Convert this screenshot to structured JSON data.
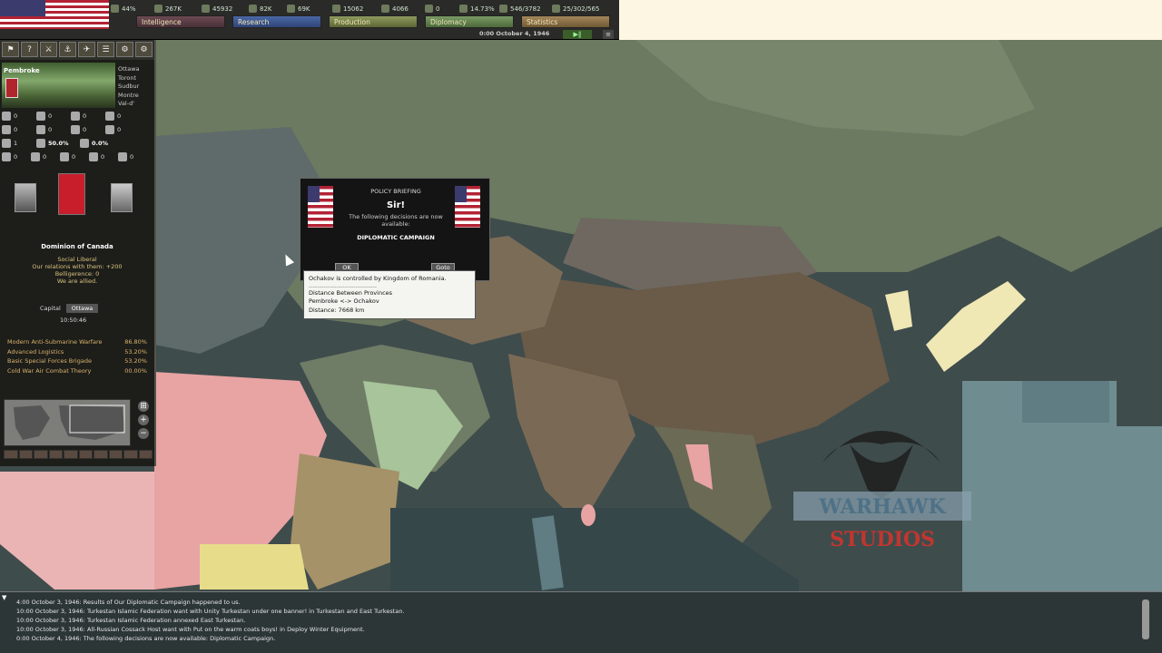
{
  "topbar": {
    "resources": [
      {
        "icon": "energy-icon",
        "value": "44%"
      },
      {
        "icon": "metal-icon",
        "value": "267K"
      },
      {
        "icon": "rare-materials-icon",
        "value": "45932"
      },
      {
        "icon": "oil-icon",
        "value": "82K"
      },
      {
        "icon": "supplies-icon",
        "value": "69K"
      },
      {
        "icon": "money-icon",
        "value": "15062"
      },
      {
        "icon": "manpower-icon",
        "value": "4066"
      },
      {
        "icon": "transports-icon",
        "value": "0"
      },
      {
        "icon": "dissent-icon",
        "value": "14.73%"
      },
      {
        "icon": "national-unity-icon",
        "value": "546/3782"
      },
      {
        "icon": "officers-icon",
        "value": "25/302/565"
      }
    ],
    "tabs": [
      "Intelligence",
      "Research",
      "Production",
      "Diplomacy",
      "Statistics"
    ],
    "date": "0:00 October 4, 1946"
  },
  "left_panel": {
    "toolbar_icons": [
      "hq-icon",
      "help-icon",
      "army-icon",
      "navy-icon",
      "air-icon",
      "ledger-icon",
      "production-icon",
      "options-icon"
    ],
    "province": {
      "name": "Pembroke",
      "cities": [
        "Ottawa",
        "Toront",
        "Sudbur",
        "Montre",
        "Val-d'"
      ]
    },
    "stats": [
      [
        "0",
        "0",
        "0",
        "0"
      ],
      [
        "0",
        "0",
        "0",
        "0"
      ],
      [
        "1",
        "50.0%",
        "0.0%"
      ],
      [
        "0",
        "0",
        "0",
        "0",
        "0"
      ]
    ],
    "country": {
      "name": "Dominion of Canada",
      "info": [
        "Social Liberal",
        "Our relations with them: +200",
        "Belligerence: 0",
        "We are allied."
      ],
      "capital_label": "Capital",
      "capital": "Ottawa",
      "clock": "10:50:46"
    },
    "techs": [
      {
        "name": "Modern Anti-Submarine Warfare",
        "pct": "86.80%"
      },
      {
        "name": "Advanced Logistics",
        "pct": "53.20%"
      },
      {
        "name": "Basic Special Forces Brigade",
        "pct": "53.20%"
      },
      {
        "name": "Cold War Air Combat Theory",
        "pct": "00.00%"
      }
    ]
  },
  "popup": {
    "heading": "POLICY BRIEFING",
    "title": "Sir!",
    "body": "The following decisions are now available:",
    "campaign": "DIPLOMATIC CAMPAIGN",
    "ok_label": "OK",
    "goto_label": "Goto"
  },
  "tooltip": {
    "line1": "Ochakov is controlled by Kingdom of Romania.",
    "separator": "--------------------------------",
    "line2": "Distance Between Provinces",
    "line3": "Pembroke <-> Ochakov",
    "line4": "Distance: 7668 km"
  },
  "watermark": {
    "top": "WARHAWK",
    "bottom": "STUDIOS"
  },
  "log": [
    "4:00 October 3, 1946: Results of Our Diplomatic Campaign happened to us.",
    "10:00 October 3, 1946: Turkestan Islamic Federation want with Unity Turkestan under one banner! in Turkestan and East Turkestan.",
    "10:00 October 3, 1946: Turkestan Islamic Federation annexed East Turkestan.",
    "10:00 October 3, 1946: All-Russian Cossack Host want with Put on the warm coats boys! in Deploy Winter Equipment.",
    "0:00 October 4, 1946: The following decisions are now available: Diplomatic Campaign."
  ]
}
